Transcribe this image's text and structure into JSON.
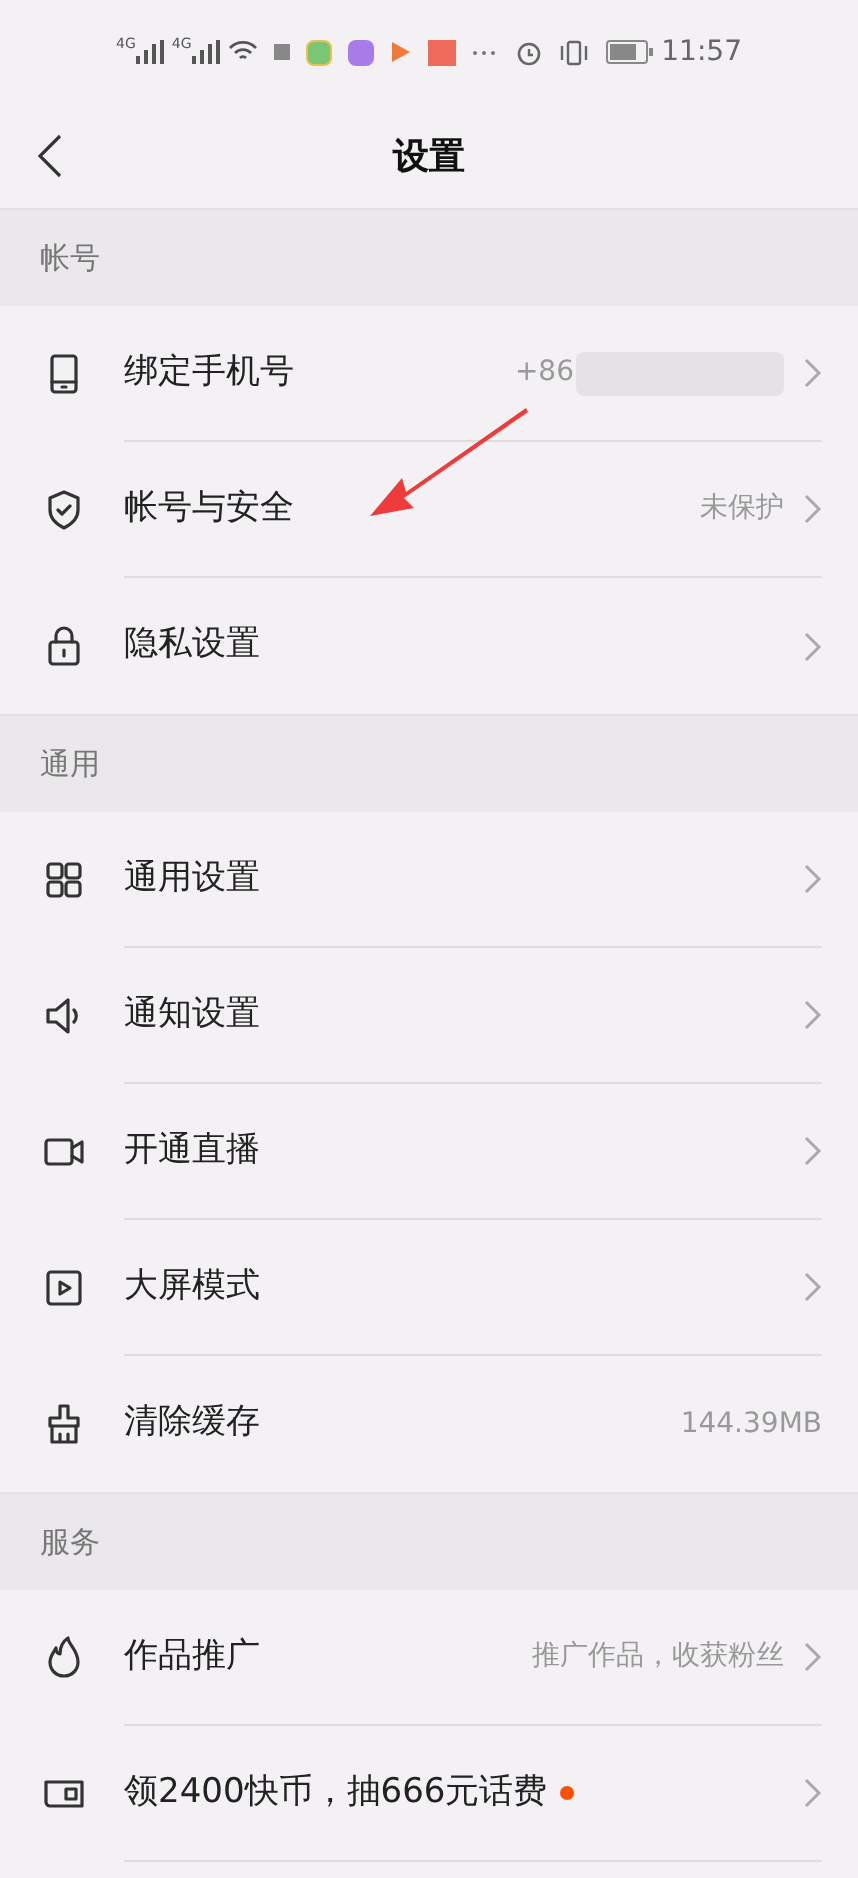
{
  "status_bar": {
    "network_1": "4G",
    "network_2": "4G",
    "time": "11:57"
  },
  "nav": {
    "title": "设置"
  },
  "sections": [
    {
      "title": "帐号",
      "items": [
        {
          "label": "绑定手机号",
          "value": "+86",
          "redacted": true,
          "badge": false
        },
        {
          "label": "帐号与安全",
          "value": "未保护",
          "redacted": false,
          "badge": false
        },
        {
          "label": "隐私设置",
          "redacted": false,
          "badge": false
        }
      ]
    },
    {
      "title": "通用",
      "items": [
        {
          "label": "通用设置",
          "redacted": false,
          "badge": false
        },
        {
          "label": "通知设置",
          "redacted": false,
          "badge": false
        },
        {
          "label": "开通直播",
          "redacted": false,
          "badge": false
        },
        {
          "label": "大屏模式",
          "redacted": false,
          "badge": false
        },
        {
          "label": "清除缓存",
          "value": "144.39MB",
          "redacted": false,
          "badge": false,
          "chevron": false
        }
      ]
    },
    {
      "title": "服务",
      "items": [
        {
          "label": "作品推广",
          "value": "推广作品，收获粉丝",
          "redacted": false,
          "badge": false
        },
        {
          "label": "领2400快币，抽666元话费",
          "redacted": false,
          "badge": true
        }
      ]
    }
  ]
}
